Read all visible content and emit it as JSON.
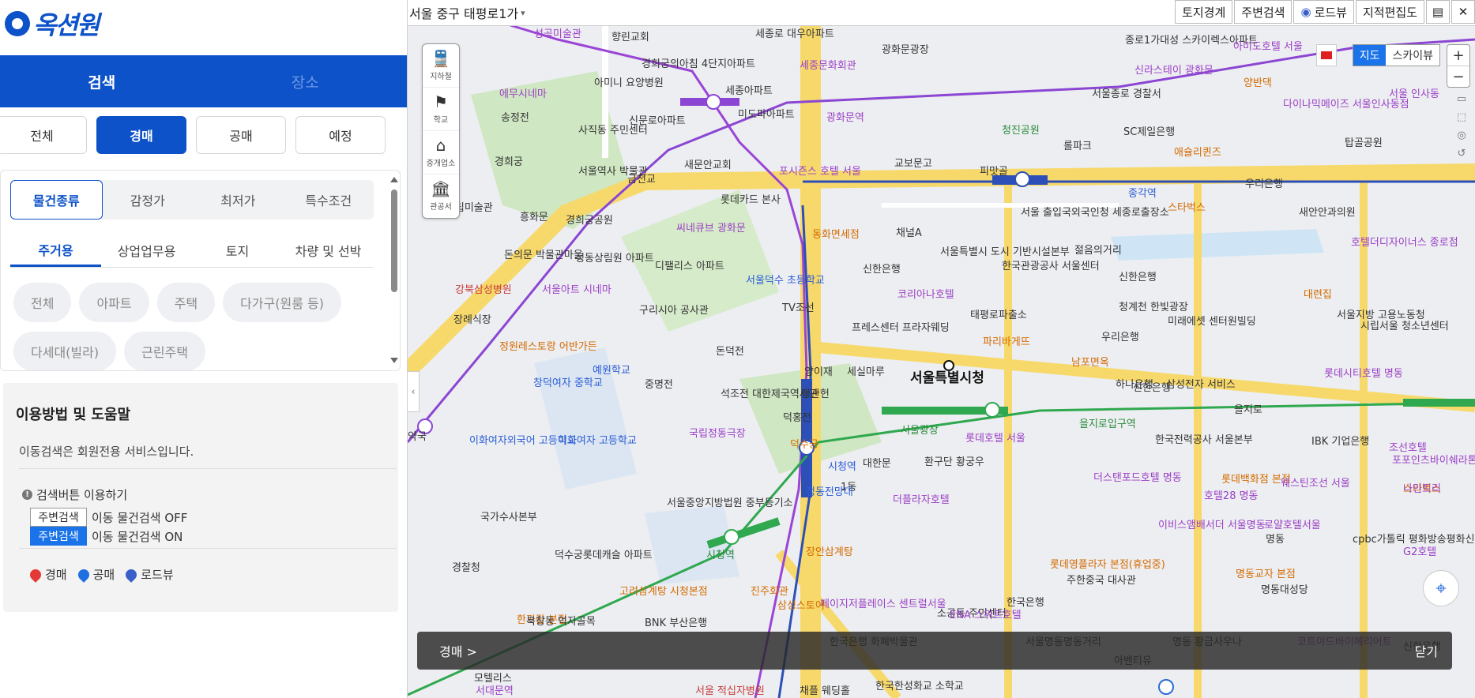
{
  "logo": {
    "text": "옥션원"
  },
  "mode_tabs": [
    {
      "label": "검색"
    },
    {
      "label": "장소"
    }
  ],
  "type_buttons": [
    {
      "label": "전체"
    },
    {
      "label": "경매"
    },
    {
      "label": "공매"
    },
    {
      "label": "예정"
    }
  ],
  "filter": {
    "segments": [
      {
        "label": "물건종류"
      },
      {
        "label": "감정가"
      },
      {
        "label": "최저가"
      },
      {
        "label": "특수조건"
      }
    ],
    "subtabs": [
      {
        "label": "주거용"
      },
      {
        "label": "상업업무용"
      },
      {
        "label": "토지"
      },
      {
        "label": "차량 및 선박"
      }
    ],
    "chips": [
      {
        "label": "전체"
      },
      {
        "label": "아파트"
      },
      {
        "label": "주택"
      },
      {
        "label": "다가구(원룸 등)"
      },
      {
        "label": "다세대(빌라)"
      },
      {
        "label": "근린주택"
      }
    ]
  },
  "help": {
    "title": "이용방법 및 도움말",
    "desc": "이동검색은 회원전용 서비스입니다.",
    "search_button_title": "검색버튼 이용하기",
    "btn_label": "주변검색",
    "off_text": "이동 물건검색 OFF",
    "on_text": "이동 물건검색 ON",
    "markers": [
      {
        "label": "경매",
        "color": "#e53935"
      },
      {
        "label": "공매",
        "color": "#1e6fe0"
      },
      {
        "label": "로드뷰",
        "color": "#3a5fc9"
      }
    ]
  },
  "map": {
    "address": "서울 중구 태평로1가",
    "top_buttons": [
      {
        "label": "토지경계"
      },
      {
        "label": "주변검색"
      },
      {
        "label": "로드뷰"
      },
      {
        "label": "지적편집도"
      }
    ],
    "tools": [
      {
        "label": "지하철"
      },
      {
        "label": "학교"
      },
      {
        "label": "중개업소"
      },
      {
        "label": "관공서"
      }
    ],
    "map_types": [
      {
        "label": "지도"
      },
      {
        "label": "스카이뷰"
      }
    ],
    "zoom": {
      "plus": "+",
      "minus": "−"
    },
    "auction_bar": {
      "left": "경매 >",
      "right": "닫기"
    },
    "labels": [
      {
        "t": "성곡미술관",
        "c": "purple"
      },
      {
        "t": "향린교회",
        "c": ""
      },
      {
        "t": "세종로 대우아파트",
        "c": ""
      },
      {
        "t": "경희궁의아침 4단지아파트",
        "c": ""
      },
      {
        "t": "아미니 요양병원",
        "c": ""
      },
      {
        "t": "세종문화회관",
        "c": "purple"
      },
      {
        "t": "광화문광장",
        "c": ""
      },
      {
        "t": "종로1가대성 스카이렉스아파트",
        "c": ""
      },
      {
        "t": "아미도호텔 서울",
        "c": "purple"
      },
      {
        "t": "신라스테이 광화문",
        "c": "purple"
      },
      {
        "t": "에무시네마",
        "c": "purple"
      },
      {
        "t": "송정전",
        "c": ""
      },
      {
        "t": "세종아파트",
        "c": ""
      },
      {
        "t": "미도파아파트",
        "c": ""
      },
      {
        "t": "사직동 주민센터",
        "c": ""
      },
      {
        "t": "신문로아파트",
        "c": ""
      },
      {
        "t": "광화문역",
        "c": "purple"
      },
      {
        "t": "청진공원",
        "c": "green"
      },
      {
        "t": "서울종로 경찰서",
        "c": ""
      },
      {
        "t": "양반댁",
        "c": "orange"
      },
      {
        "t": "다이나믹메이즈 서울인사동점",
        "c": "purple"
      },
      {
        "t": "서울 인사동",
        "c": "purple"
      },
      {
        "t": "탑골공원",
        "c": ""
      },
      {
        "t": "SC제일은행",
        "c": ""
      },
      {
        "t": "롤파크",
        "c": ""
      },
      {
        "t": "애슐리퀸즈",
        "c": "orange"
      },
      {
        "t": "경희궁",
        "c": ""
      },
      {
        "t": "서울역사 박물관",
        "c": ""
      },
      {
        "t": "새문안교회",
        "c": ""
      },
      {
        "t": "교보문고",
        "c": ""
      },
      {
        "t": "피맛골",
        "c": ""
      },
      {
        "t": "우리은행",
        "c": ""
      },
      {
        "t": "종각역",
        "c": "blue"
      },
      {
        "t": "금천교",
        "c": ""
      },
      {
        "t": "포시즌스 호텔 서울",
        "c": "purple"
      },
      {
        "t": "스타벅스",
        "c": "orange"
      },
      {
        "t": "롯데카드 본사",
        "c": ""
      },
      {
        "t": "서울 출입국외국인청 세종로출장소",
        "c": ""
      },
      {
        "t": "새안안과의원",
        "c": ""
      },
      {
        "t": "흥화문",
        "c": ""
      },
      {
        "t": "경희궁공원",
        "c": ""
      },
      {
        "t": "서울시립미술관",
        "c": ""
      },
      {
        "t": "동화면세점",
        "c": "orange"
      },
      {
        "t": "채널A",
        "c": ""
      },
      {
        "t": "씨네큐브 광화문",
        "c": "purple"
      },
      {
        "t": "서울특별시 도시 기반시설본부",
        "c": ""
      },
      {
        "t": "젊음의거리",
        "c": ""
      },
      {
        "t": "호텔더디자이너스 종로점",
        "c": "purple"
      },
      {
        "t": "돈의문 박물관마을",
        "c": ""
      },
      {
        "t": "정동상림원 아파트",
        "c": ""
      },
      {
        "t": "디팰리스 아파트",
        "c": ""
      },
      {
        "t": "신한은행",
        "c": ""
      },
      {
        "t": "한국관광공사 서울센터",
        "c": ""
      },
      {
        "t": "신한은행",
        "c": ""
      },
      {
        "t": "강북삼성병원",
        "c": "red"
      },
      {
        "t": "서울덕수 초등학교",
        "c": "blue"
      },
      {
        "t": "청계천 한빛광장",
        "c": ""
      },
      {
        "t": "대련집",
        "c": "orange"
      },
      {
        "t": "서울아트 시네마",
        "c": "purple"
      },
      {
        "t": "구리시아 공사관",
        "c": ""
      },
      {
        "t": "TV조선",
        "c": ""
      },
      {
        "t": "코리아나호텔",
        "c": "purple"
      },
      {
        "t": "태평로파출소",
        "c": ""
      },
      {
        "t": "서울지방 고용노동청",
        "c": ""
      },
      {
        "t": "시립서울 청소년센터",
        "c": ""
      },
      {
        "t": "장례식장",
        "c": ""
      },
      {
        "t": "프레스센터 프라자웨딩",
        "c": ""
      },
      {
        "t": "파리바게뜨",
        "c": "orange"
      },
      {
        "t": "우리은행",
        "c": ""
      },
      {
        "t": "미래에셋 센터원빌딩",
        "c": ""
      },
      {
        "t": "정원레스토랑 어반가든",
        "c": "orange"
      },
      {
        "t": "돈덕전",
        "c": ""
      },
      {
        "t": "남포면옥",
        "c": "orange"
      },
      {
        "t": "양이재",
        "c": ""
      },
      {
        "t": "세실마루",
        "c": ""
      },
      {
        "t": "서울특별시청",
        "c": "big"
      },
      {
        "t": "예원학교",
        "c": "blue"
      },
      {
        "t": "중명전",
        "c": ""
      },
      {
        "t": "석조전 대한제국역사관",
        "c": ""
      },
      {
        "t": "정관헌",
        "c": ""
      },
      {
        "t": "덕홍전",
        "c": ""
      },
      {
        "t": "하나은행",
        "c": ""
      },
      {
        "t": "삼성전자 서비스",
        "c": ""
      },
      {
        "t": "롯데시티호텔 명동",
        "c": "purple"
      },
      {
        "t": "신한은행",
        "c": ""
      },
      {
        "t": "창덕여자 중학교",
        "c": "blue"
      },
      {
        "t": "서울광장",
        "c": "green"
      },
      {
        "t": "을지로입구역",
        "c": "green"
      },
      {
        "t": "을지로",
        "c": ""
      },
      {
        "t": "국립정동극장",
        "c": "purple"
      },
      {
        "t": "한국전력공사 서울본부",
        "c": ""
      },
      {
        "t": "IBK 기업은행",
        "c": ""
      },
      {
        "t": "이화여자외국어 고등학교",
        "c": "blue"
      },
      {
        "t": "이화여자 고등학교",
        "c": "blue"
      },
      {
        "t": "덕수궁",
        "c": "orange"
      },
      {
        "t": "롯데호텔 서울",
        "c": "purple"
      },
      {
        "t": "조선호텔",
        "c": "purple"
      },
      {
        "t": "포포인츠바이쉐라톤 서울",
        "c": "purple"
      },
      {
        "t": "대한문",
        "c": ""
      },
      {
        "t": "시청역",
        "c": "blue"
      },
      {
        "t": "환구단 황궁우",
        "c": ""
      },
      {
        "t": "더스탠포드호텔 명동",
        "c": "purple"
      },
      {
        "t": "롯데백화점 본점",
        "c": "orange"
      },
      {
        "t": "웨스틴조선 서울",
        "c": "purple"
      },
      {
        "t": "호텔28 명동",
        "c": "purple"
      },
      {
        "t": "스타벅스",
        "c": "orange"
      },
      {
        "t": "나인트리",
        "c": "purple"
      },
      {
        "t": "1동",
        "c": ""
      },
      {
        "t": "정동전망대",
        "c": "blue"
      },
      {
        "t": "더플라자호텔",
        "c": "purple"
      },
      {
        "t": "서울중앙지방법원 중부등기소",
        "c": ""
      },
      {
        "t": "국가수사본부",
        "c": ""
      },
      {
        "t": "이비스앰배서더 서울명동",
        "c": "purple"
      },
      {
        "t": "로얄호텔서울",
        "c": "purple"
      },
      {
        "t": "명동",
        "c": ""
      },
      {
        "t": "cpbc가톨릭 평화방송평화신문",
        "c": ""
      },
      {
        "t": "G2호텔",
        "c": "purple"
      },
      {
        "t": "덕수궁롯데캐슬 아파트",
        "c": ""
      },
      {
        "t": "경찰청",
        "c": ""
      },
      {
        "t": "장안삼계탕",
        "c": "orange"
      },
      {
        "t": "시청역",
        "c": "green"
      },
      {
        "t": "롯데영플라자 본점(휴업중)",
        "c": "orange"
      },
      {
        "t": "주한중국 대사관",
        "c": ""
      },
      {
        "t": "명동교자 본점",
        "c": "orange"
      },
      {
        "t": "명동대성당",
        "c": ""
      },
      {
        "t": "고려삼계탕 시청본점",
        "c": "orange"
      },
      {
        "t": "진주회관",
        "c": "orange"
      },
      {
        "t": "한국은행",
        "c": ""
      },
      {
        "t": "페이지저플레이스 센트럴서울",
        "c": "purple"
      },
      {
        "t": "소공동 주민센터",
        "c": ""
      },
      {
        "t": "한가람 본점",
        "c": "orange"
      },
      {
        "t": "삼성스토어",
        "c": "orange"
      },
      {
        "t": "ENA 스위트호텔",
        "c": "purple"
      },
      {
        "t": "BNK 부산은행",
        "c": ""
      },
      {
        "t": "북창동 먹자골목",
        "c": ""
      },
      {
        "t": "한국은행 화폐박물관",
        "c": ""
      },
      {
        "t": "서울명동",
        "c": ""
      },
      {
        "t": "명동거리",
        "c": ""
      },
      {
        "t": "명동 황금사우나",
        "c": ""
      },
      {
        "t": "코트야드바이메리어트",
        "c": "purple"
      },
      {
        "t": "신한은행",
        "c": ""
      },
      {
        "t": "한국한성화교 소학교",
        "c": ""
      },
      {
        "t": "채플 웨딩홀",
        "c": ""
      },
      {
        "t": "아벤티유",
        "c": ""
      },
      {
        "t": "모텔리스",
        "c": ""
      },
      {
        "t": "서대문역",
        "c": "purple"
      },
      {
        "t": "서울 적십자병원",
        "c": "red"
      },
      {
        "t": "약국",
        "c": ""
      }
    ]
  }
}
